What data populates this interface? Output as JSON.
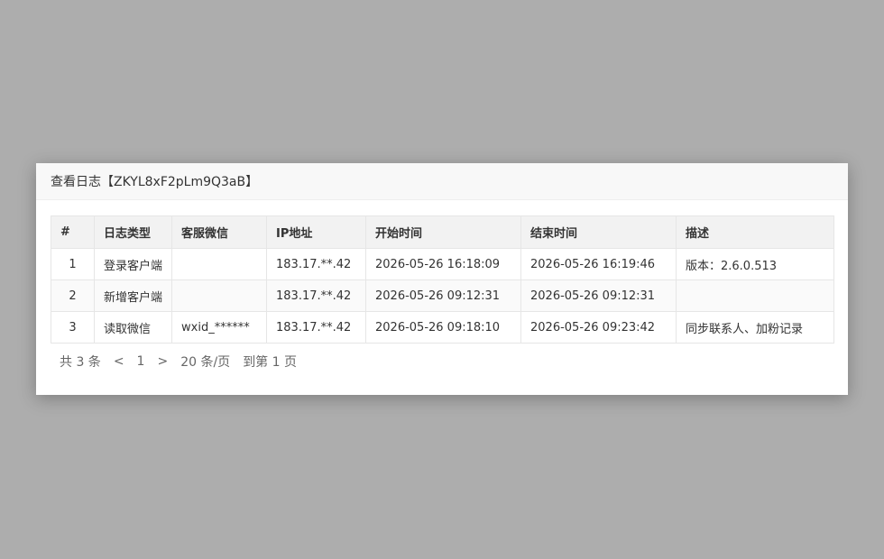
{
  "dialog": {
    "title": "查看日志【ZKYL8xF2pLm9Q3aB】"
  },
  "table": {
    "headers": [
      "#",
      "日志类型",
      "客服微信",
      "IP地址",
      "开始时间",
      "结束时间",
      "描述"
    ],
    "rows": [
      [
        "1",
        "登录客户端",
        "",
        "183.17.**.42",
        "2026-05-26 16:18:09",
        "2026-05-26 16:19:46",
        "版本：2.6.0.513"
      ],
      [
        "2",
        "新增客户端",
        "",
        "183.17.**.42",
        "2026-05-26 09:12:31",
        "2026-05-26 09:12:31",
        ""
      ],
      [
        "3",
        "读取微信",
        "wxid_******",
        "183.17.**.42",
        "2026-05-26 09:18:10",
        "2026-05-26 09:23:42",
        "同步联系人、加粉记录"
      ]
    ]
  },
  "pager": {
    "total": "共 3 条",
    "prev": "<",
    "current": "1",
    "next": ">",
    "page_size": "20 条/页",
    "goto": "到第 1 页"
  }
}
